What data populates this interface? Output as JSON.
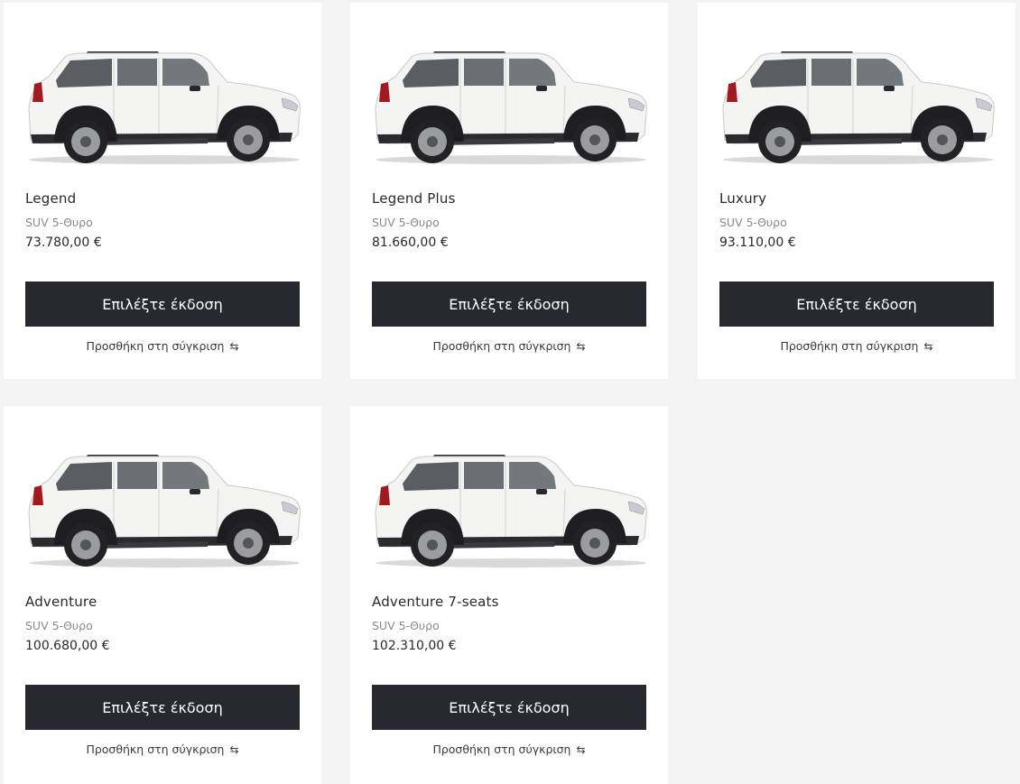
{
  "colors": {
    "page_bg": "#f3f3f3",
    "card_bg": "#ffffff",
    "button_bg": "#282830",
    "button_text": "#ffffff",
    "muted_text": "#8a8a8f"
  },
  "cards": [
    {
      "name": "Legend",
      "body": "SUV 5-Θυρο",
      "price": "73.780,00 €",
      "cta": "Επιλέξτε έκδοση",
      "compare": "Προσθήκη στη σύγκριση",
      "image": "white-suv-side-view"
    },
    {
      "name": "Legend Plus",
      "body": "SUV 5-Θυρο",
      "price": "81.660,00 €",
      "cta": "Επιλέξτε έκδοση",
      "compare": "Προσθήκη στη σύγκριση",
      "image": "white-suv-side-view"
    },
    {
      "name": "Luxury",
      "body": "SUV 5-Θυρο",
      "price": "93.110,00 €",
      "cta": "Επιλέξτε έκδοση",
      "compare": "Προσθήκη στη σύγκριση",
      "image": "white-suv-side-view"
    },
    {
      "name": "Adventure",
      "body": "SUV 5-Θυρο",
      "price": "100.680,00 €",
      "cta": "Επιλέξτε έκδοση",
      "compare": "Προσθήκη στη σύγκριση",
      "image": "white-suv-side-view"
    },
    {
      "name": "Adventure 7-seats",
      "body": "SUV 5-Θυρο",
      "price": "102.310,00 €",
      "cta": "Επιλέξτε έκδοση",
      "compare": "Προσθήκη στη σύγκριση",
      "image": "white-suv-side-view"
    }
  ],
  "icons": {
    "compare": "compare-arrows-icon"
  }
}
